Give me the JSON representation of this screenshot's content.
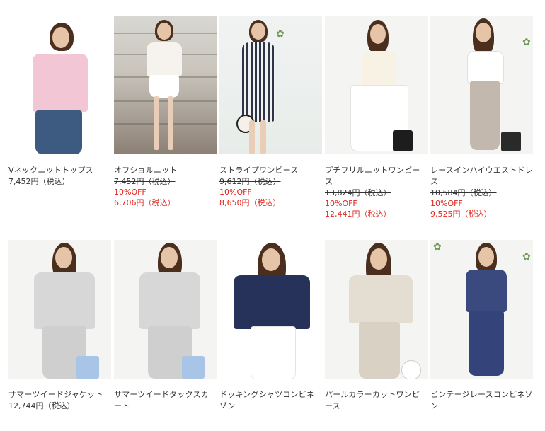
{
  "products_row1": [
    {
      "name": "Vネックニットトップス",
      "price": "7,452円（税込）"
    },
    {
      "name": "オフショルニット",
      "old_price": "7,452円（税込）",
      "discount": "10%OFF",
      "sale_price": "6,706円（税込）"
    },
    {
      "name": "ストライプワンピース",
      "old_price": "9,612円（税込）",
      "discount": "10%OFF",
      "sale_price": "8,650円（税込）"
    },
    {
      "name": "プチフリルニットワンピース",
      "old_price": "13,824円（税込）",
      "discount": "10%OFF",
      "sale_price": "12,441円（税込）"
    },
    {
      "name": "レースインハイウエストドレス",
      "old_price": "10,584円（税込）",
      "discount": "10%OFF",
      "sale_price": "9,525円（税込）"
    }
  ],
  "products_row2": [
    {
      "name": "サマーツイードジャケット",
      "old_price": "12,744円（税込）"
    },
    {
      "name": "サマーツイードタックスカート"
    },
    {
      "name": "ドッキングシャツコンビネゾン"
    },
    {
      "name": "パールカラーカットワンピース"
    },
    {
      "name": "ビンテージレースコンビネゾン"
    }
  ],
  "colors": {
    "sale_red": "#e0251b",
    "text": "#333333"
  }
}
